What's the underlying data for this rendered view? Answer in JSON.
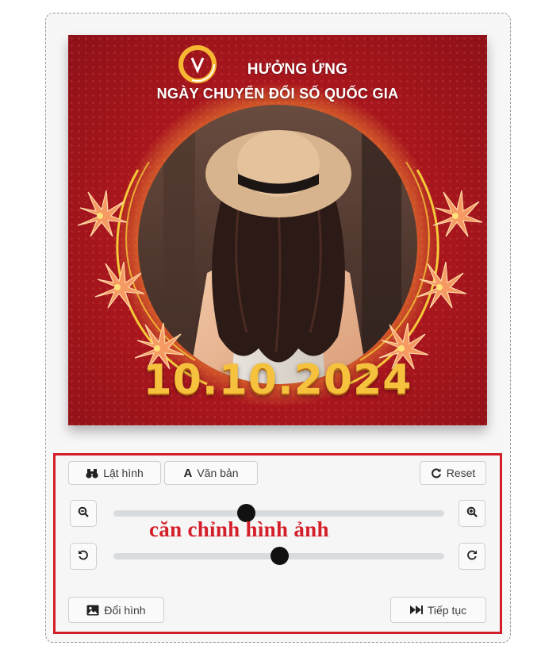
{
  "frame": {
    "title_line1": "HƯỞNG ỨNG",
    "title_line2": "NGÀY CHUYỂN ĐỔI SỐ QUỐC GIA",
    "date": "10.10.2024"
  },
  "toolbar": {
    "flip_label": "Lật hình",
    "text_label": "Văn bản",
    "reset_label": "Reset"
  },
  "sliders": {
    "zoom_level": 0.4,
    "rotate_level": 0.5
  },
  "annotation": "căn chỉnh hình ảnh",
  "footer": {
    "change_label": "Đổi hình",
    "continue_label": "Tiếp tục"
  },
  "colors": {
    "frame_red": "#a8161d",
    "gold": "#f6c23e",
    "highlight_red": "#d41f2a"
  }
}
